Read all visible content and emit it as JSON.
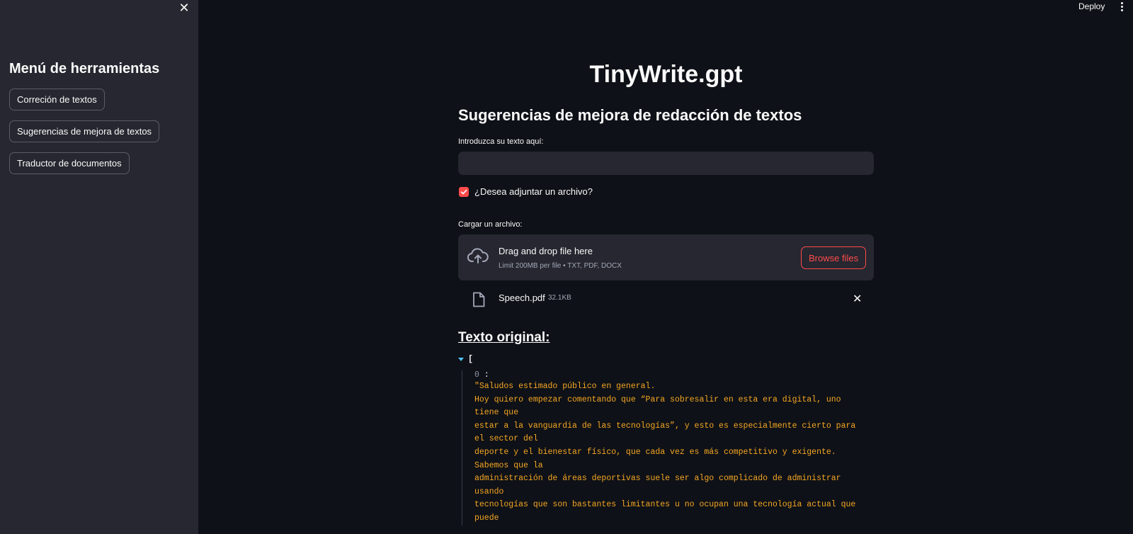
{
  "sidebar": {
    "close_icon": "close-icon",
    "title": "Menú de herramientas",
    "items": [
      {
        "label": "Correción de textos"
      },
      {
        "label": "Sugerencias de mejora de textos"
      },
      {
        "label": "Traductor de documentos"
      }
    ]
  },
  "header": {
    "deploy_label": "Deploy",
    "menu_icon": "vertical-dots-icon"
  },
  "main": {
    "title": "TinyWrite.gpt",
    "subtitle": "Sugerencias de mejora de redacción de textos",
    "text_input": {
      "label": "Introduzca su texto aquí:",
      "value": ""
    },
    "attach_checkbox": {
      "label": "¿Desea adjuntar un archivo?",
      "checked": true
    },
    "uploader": {
      "label": "Cargar un archivo:",
      "drop_title": "Drag and drop file here",
      "drop_limit": "Limit 200MB per file • TXT, PDF, DOCX",
      "browse_label": "Browse files",
      "icon": "cloud-upload-icon"
    },
    "uploaded_file": {
      "name": "Speech.pdf",
      "size": "32.1KB",
      "icon": "file-icon"
    },
    "original_section": {
      "title": "Texto original:",
      "bracket": "[",
      "key": "0",
      "colon": ":",
      "value": "\"Saludos estimado público en general.\nHoy quiero empezar comentando que “Para sobresalir en esta era digital, uno\ntiene que\nestar a la vanguardia de las tecnologías”, y esto es especialmente cierto para\nel sector del\ndeporte y el bienestar físico, que cada vez es más competitivo y exigente.\nSabemos que la\nadministración de áreas deportivas suele ser algo complicado de administrar\nusando\ntecnologías que son bastantes limitantes u no ocupan una tecnología actual que\npuede"
    }
  },
  "colors": {
    "background": "#0e1117",
    "sidebar": "#262730",
    "accent": "#ff4b4b",
    "json_string": "#f5a623",
    "json_toggle": "#4fc3f7"
  }
}
